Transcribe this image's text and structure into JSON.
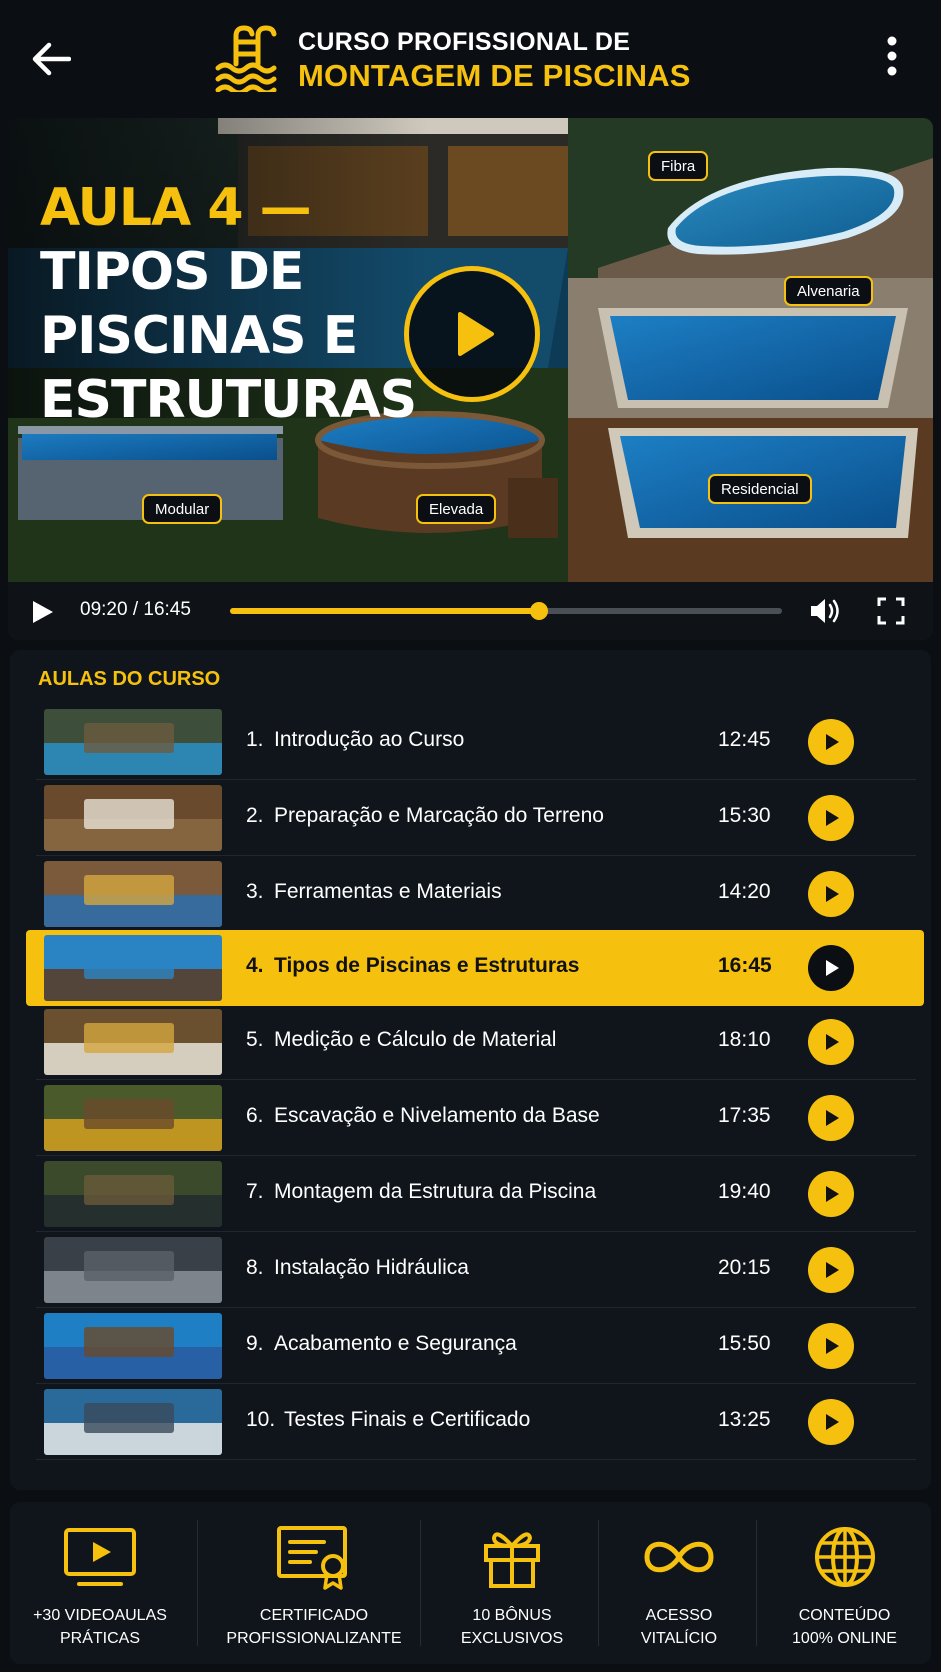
{
  "header": {
    "title_line1": "CURSO PROFISSIONAL DE",
    "title_line2": "MONTAGEM DE PISCINAS",
    "back_icon": "arrow-left-icon",
    "menu_icon": "more-vertical-icon",
    "logo_icon": "pool-ladder-icon"
  },
  "video": {
    "title_prefix": "AULA 4 —",
    "title_lines": [
      "TIPOS DE",
      "PISCINAS E",
      "ESTRUTURAS"
    ],
    "tags": {
      "fibra": "Fibra",
      "alvenaria": "Alvenaria",
      "residencial": "Residencial",
      "modular": "Modular",
      "elevada": "Elevada"
    },
    "time": "09:20 / 16:45",
    "progress": 0.56
  },
  "lessons": {
    "section_title": "AULAS DO CURSO",
    "items": [
      {
        "num": "1.",
        "title": "Introdução ao Curso",
        "duration": "12:45"
      },
      {
        "num": "2.",
        "title": "Preparação e Marcação do Terreno",
        "duration": "15:30"
      },
      {
        "num": "3.",
        "title": "Ferramentas e Materiais",
        "duration": "14:20"
      },
      {
        "num": "4.",
        "title": "Tipos de Piscinas e Estruturas",
        "duration": "16:45",
        "active": true
      },
      {
        "num": "5.",
        "title": "Medição e Cálculo de Material",
        "duration": "18:10"
      },
      {
        "num": "6.",
        "title": "Escavação e Nivelamento da Base",
        "duration": "17:35"
      },
      {
        "num": "7.",
        "title": "Montagem da Estrutura da Piscina",
        "duration": "19:40"
      },
      {
        "num": "8.",
        "title": "Instalação Hidráulica",
        "duration": "20:15"
      },
      {
        "num": "9.",
        "title": "Acabamento e Segurança",
        "duration": "15:50"
      },
      {
        "num": "10.",
        "title": "Testes Finais e Certificado",
        "duration": "13:25"
      }
    ]
  },
  "features": [
    {
      "line1": "+30 VIDEOAULAS",
      "line2": "PRÁTICAS",
      "icon": "video-play-icon"
    },
    {
      "line1": "CERTIFICADO",
      "line2": "PROFISSIONALIZANTE",
      "icon": "certificate-icon"
    },
    {
      "line1": "10 BÔNUS",
      "line2": "EXCLUSIVOS",
      "icon": "gift-icon"
    },
    {
      "line1": "ACESSO",
      "line2": "VITALÍCIO",
      "icon": "infinity-icon"
    },
    {
      "line1": "CONTEÚDO",
      "line2": "100% ONLINE",
      "icon": "globe-icon"
    }
  ],
  "colors": {
    "accent": "#f6c10e",
    "background": "#0b0e13",
    "panel": "#10151c"
  }
}
